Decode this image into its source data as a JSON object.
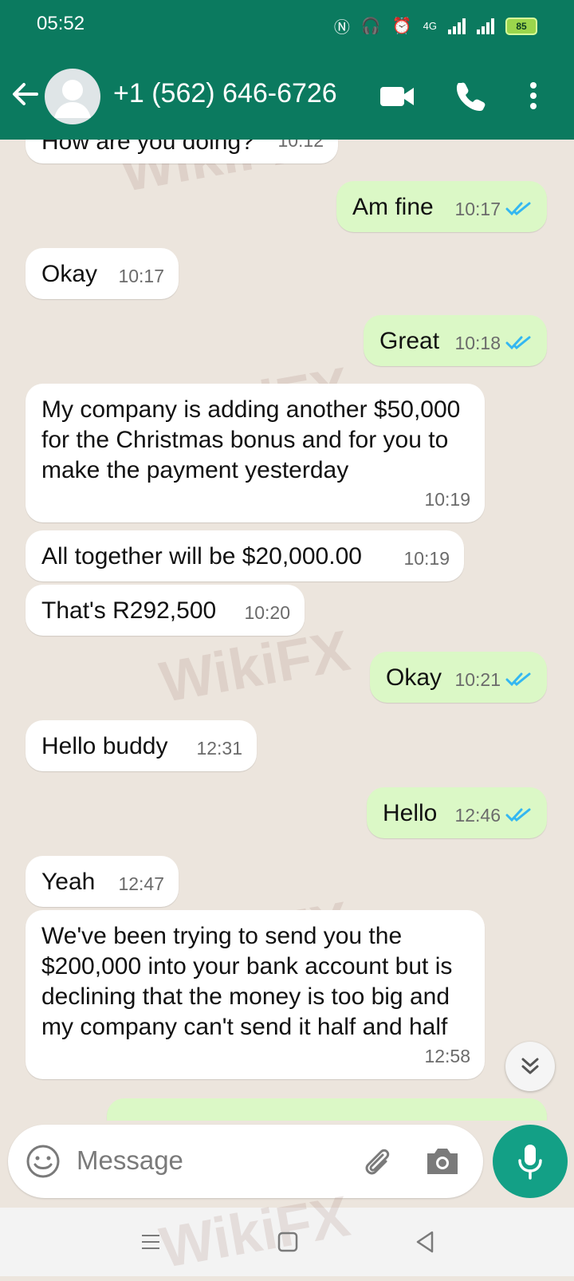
{
  "status_bar": {
    "time": "05:52",
    "battery": "85",
    "network": "4G"
  },
  "header": {
    "contact": "+1 (562) 646-6726"
  },
  "messages": [
    {
      "dir": "in",
      "text": "How are you doing?",
      "time": "10:12"
    },
    {
      "dir": "out",
      "text": "Am fine",
      "time": "10:17"
    },
    {
      "dir": "in",
      "text": "Okay",
      "time": "10:17"
    },
    {
      "dir": "out",
      "text": "Great",
      "time": "10:18"
    },
    {
      "dir": "in",
      "text": "My company is adding another $50,000 for the Christmas bonus and for you to make the payment yesterday",
      "time": "10:19"
    },
    {
      "dir": "in",
      "text": "All together will be $20,000.00",
      "time": "10:19"
    },
    {
      "dir": "in",
      "text": "That's R292,500",
      "time": "10:20"
    },
    {
      "dir": "out",
      "text": "Okay",
      "time": "10:21"
    },
    {
      "dir": "in",
      "text": "Hello buddy",
      "time": "12:31"
    },
    {
      "dir": "out",
      "text": "Hello",
      "time": "12:46"
    },
    {
      "dir": "in",
      "text": "Yeah",
      "time": "12:47"
    },
    {
      "dir": "in",
      "text": "We've been trying to send you the $200,000 into your bank account but is declining that the money is too big and my company can't send it half and half",
      "time": "12:58"
    }
  ],
  "watermark": "WikiFX",
  "input": {
    "placeholder": "Message"
  },
  "colors": {
    "header": "#0b7a5f",
    "outgoing": "#dbf8c6",
    "incoming": "#ffffff",
    "read_tick": "#34b7f1",
    "mic": "#13a086"
  }
}
